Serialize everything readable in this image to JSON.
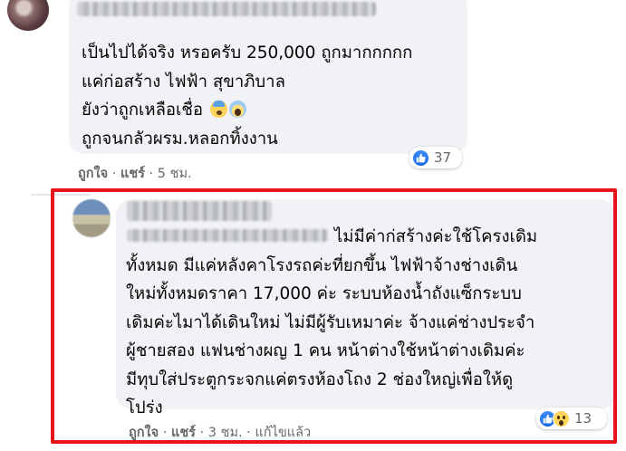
{
  "comments": [
    {
      "lines": [
        "เป็นไปได้จริง หรอครับ 250,000 ถูกมากกกกก",
        "แค่ก่อสร้าง ไฟฟ้า สุขาภิบาล",
        "ยังว่าถูกเหลือเชื่อ",
        "ถูกจนกลัวผรม.หลอกทิ้งงาน"
      ],
      "emoji_after_line_3": [
        "fearful-face-emoji",
        "screaming-face-emoji"
      ],
      "reaction_count": "37",
      "actions": {
        "like": "ถูกใจ",
        "reply": "แชร์",
        "time": "5 ชม.",
        "sep": " · "
      }
    },
    {
      "lines": [
        "ไม่มีค่าก่สร้างค่ะใช้โครงเดิม",
        "ทั้งหมด มีแค่หลังคาโรงรถค่ะที่ยกขึ้น ไฟฟ้าจ้างช่างเดิน",
        "ใหม่ทั้งหมดราคา 17,000 ค่ะ ระบบห้องน้ำถังแซ็กระบบ",
        "เดิมค่ะไมาได้เดินใหม่ ไม่มีผู้รับเหมาค่ะ จ้างแค่ช่างประจำ",
        "ผู้ชายสอง แฟนช่างผญ 1 คน หน้าต่างใช้หน้าต่างเดิมค่ะ",
        "มีทุบใส่ประตูกระจกแค่ตรงห้องโถง 2 ช่องใหญ่เพื่อให้ดู",
        "โปร่ง"
      ],
      "reaction_count": "13",
      "actions": {
        "like": "ถูกใจ",
        "reply": "แชร์",
        "time": "3 ชม.",
        "edited": "แก้ไขแล้ว",
        "sep": " · "
      }
    }
  ],
  "colors": {
    "bubble": "#f0f2f5",
    "text": "#050505",
    "meta": "#65676b",
    "like_blue": "#1877f2",
    "highlight": "#e8141c"
  }
}
